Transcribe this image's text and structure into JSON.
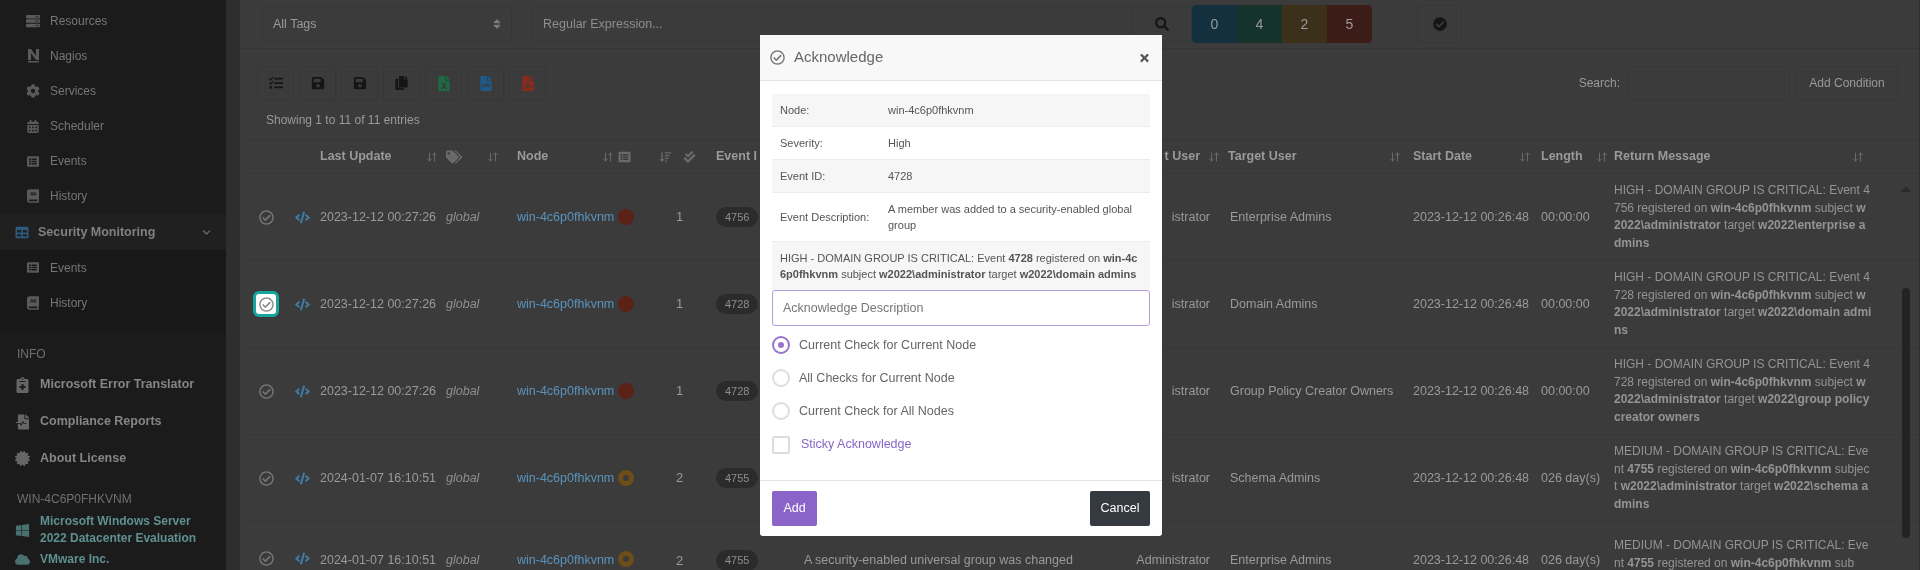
{
  "sidebar": {
    "items": [
      {
        "label": "Resources"
      },
      {
        "label": "Nagios"
      },
      {
        "label": "Services"
      },
      {
        "label": "Scheduler"
      },
      {
        "label": "Events"
      },
      {
        "label": "History"
      },
      {
        "label": "Security Monitoring",
        "expanded": true,
        "children": [
          {
            "label": "Events"
          },
          {
            "label": "History"
          }
        ]
      }
    ],
    "sections": [
      {
        "title": "INFO",
        "items": [
          {
            "label": "Microsoft Error Translator"
          },
          {
            "label": "Compliance Reports"
          },
          {
            "label": "About License"
          }
        ]
      },
      {
        "title": "WIN-4C6P0FHKVNM",
        "items": [
          {
            "label": "Microsoft Windows Server 2022 Datacenter Evaluation"
          },
          {
            "label": "VMware Inc."
          }
        ]
      }
    ]
  },
  "filters": {
    "tags_select": {
      "value": "All Tags"
    },
    "regex": {
      "placeholder": "Regular Expression..."
    },
    "severity_counts": [
      {
        "label": "0",
        "color": "#14303f"
      },
      {
        "label": "4",
        "color": "#15332a"
      },
      {
        "label": "2",
        "color": "#3b311b"
      },
      {
        "label": "5",
        "color": "#3b1c16"
      }
    ]
  },
  "toolbar": {
    "search_label": "Search:",
    "add_condition": "Add Condition",
    "info": "Showing 1 to 11 of 11 entries"
  },
  "table": {
    "columns": [
      "Last Update",
      "Node",
      "Event I",
      "t User",
      "Target User",
      "Start Date",
      "Length",
      "Return Message"
    ],
    "rows": [
      {
        "selected": false,
        "last_update": "2023-12-12 00:27:26",
        "tag": "global",
        "node": "win-4c6p0fhkvnm",
        "severity": {
          "kind": "high",
          "color": "#5c2217"
        },
        "count": "1",
        "event_id": "4756",
        "subject_user": "istrator",
        "target_user": "Enterprise Admins",
        "start_date": "2023-12-12 00:26:48",
        "length": "00:00:00",
        "message": "HIGH - DOMAIN GROUP IS CRITICAL: Event 4756 registered on **win-4c6p0fhkvnm** subject **w2022\\administrator** target **w2022\\enterprise admins**"
      },
      {
        "selected": true,
        "last_update": "2023-12-12 00:27:26",
        "tag": "global",
        "node": "win-4c6p0fhkvnm",
        "severity": {
          "kind": "high",
          "color": "#5c2217"
        },
        "count": "1",
        "event_id": "4728",
        "subject_user": "istrator",
        "target_user": "Domain Admins",
        "start_date": "2023-12-12 00:26:48",
        "length": "00:00:00",
        "message": "HIGH - DOMAIN GROUP IS CRITICAL: Event 4728 registered on **win-4c6p0fhkvnm** subject **w2022\\administrator** target **w2022\\domain admins**"
      },
      {
        "selected": false,
        "last_update": "2023-12-12 00:27:26",
        "tag": "global",
        "node": "win-4c6p0fhkvnm",
        "severity": {
          "kind": "high",
          "color": "#5c2217"
        },
        "count": "1",
        "event_id": "4728",
        "subject_user": "istrator",
        "target_user": "Group Policy Creator Owners",
        "start_date": "2023-12-12 00:26:48",
        "length": "00:00:00",
        "message": "HIGH - DOMAIN GROUP IS CRITICAL: Event 4728 registered on **win-4c6p0fhkvnm** subject **w2022\\administrator** target **w2022\\group policy creator owners**"
      },
      {
        "selected": false,
        "last_update": "2024-01-07 16:10:51",
        "tag": "global",
        "node": "win-4c6p0fhkvnm",
        "severity": {
          "kind": "medium",
          "color": "#6e4d18"
        },
        "count": "2",
        "event_id": "4755",
        "subject_user": "istrator",
        "target_user": "Schema Admins",
        "start_date": "2023-12-12 00:26:48",
        "length": "026 day(s)",
        "message": "MEDIUM - DOMAIN GROUP IS CRITICAL: Event **4755** registered on **win-4c6p0fhkvnm** subject **w2022\\administrator** target **w2022\\schema admins**"
      },
      {
        "selected": false,
        "last_update": "2024-01-07 16:10:51",
        "tag": "global",
        "node": "win-4c6p0fhkvnm",
        "severity": {
          "kind": "medium",
          "color": "#6e4d18"
        },
        "count": "2",
        "event_id": "4755",
        "description": "A security-enabled universal group was changed",
        "subject_user": "Administrator",
        "target_user": "Enterprise Admins",
        "start_date": "2023-12-12 00:26:48",
        "length": "026 day(s)",
        "message": "MEDIUM - DOMAIN GROUP IS CRITICAL: Event **4755** registered on **win-4c6p0fhkvnm** sub"
      }
    ]
  },
  "modal": {
    "title": "Acknowledge",
    "details": [
      {
        "label": "Node:",
        "value": "win-4c6p0fhkvnm"
      },
      {
        "label": "Severity:",
        "value": "High"
      },
      {
        "label": "Event ID:",
        "value": "4728"
      },
      {
        "label": "Event Description:",
        "value": "A member was added to a security-enabled global group"
      }
    ],
    "message": "HIGH - DOMAIN GROUP IS CRITICAL: Event **4728** registered on **win-4c6p0fhkvnm** subject **w2022\\administrator** target **w2022\\domain admins**",
    "input": {
      "placeholder": "Acknowledge Description"
    },
    "scope_options": [
      {
        "label": "Current Check for Current Node",
        "selected": true
      },
      {
        "label": "All Checks for Current Node",
        "selected": false
      },
      {
        "label": "Current Check for All Nodes",
        "selected": false
      }
    ],
    "sticky": {
      "label": "Sticky Acknowledge",
      "checked": false
    },
    "buttons": {
      "add": "Add",
      "cancel": "Cancel"
    }
  }
}
